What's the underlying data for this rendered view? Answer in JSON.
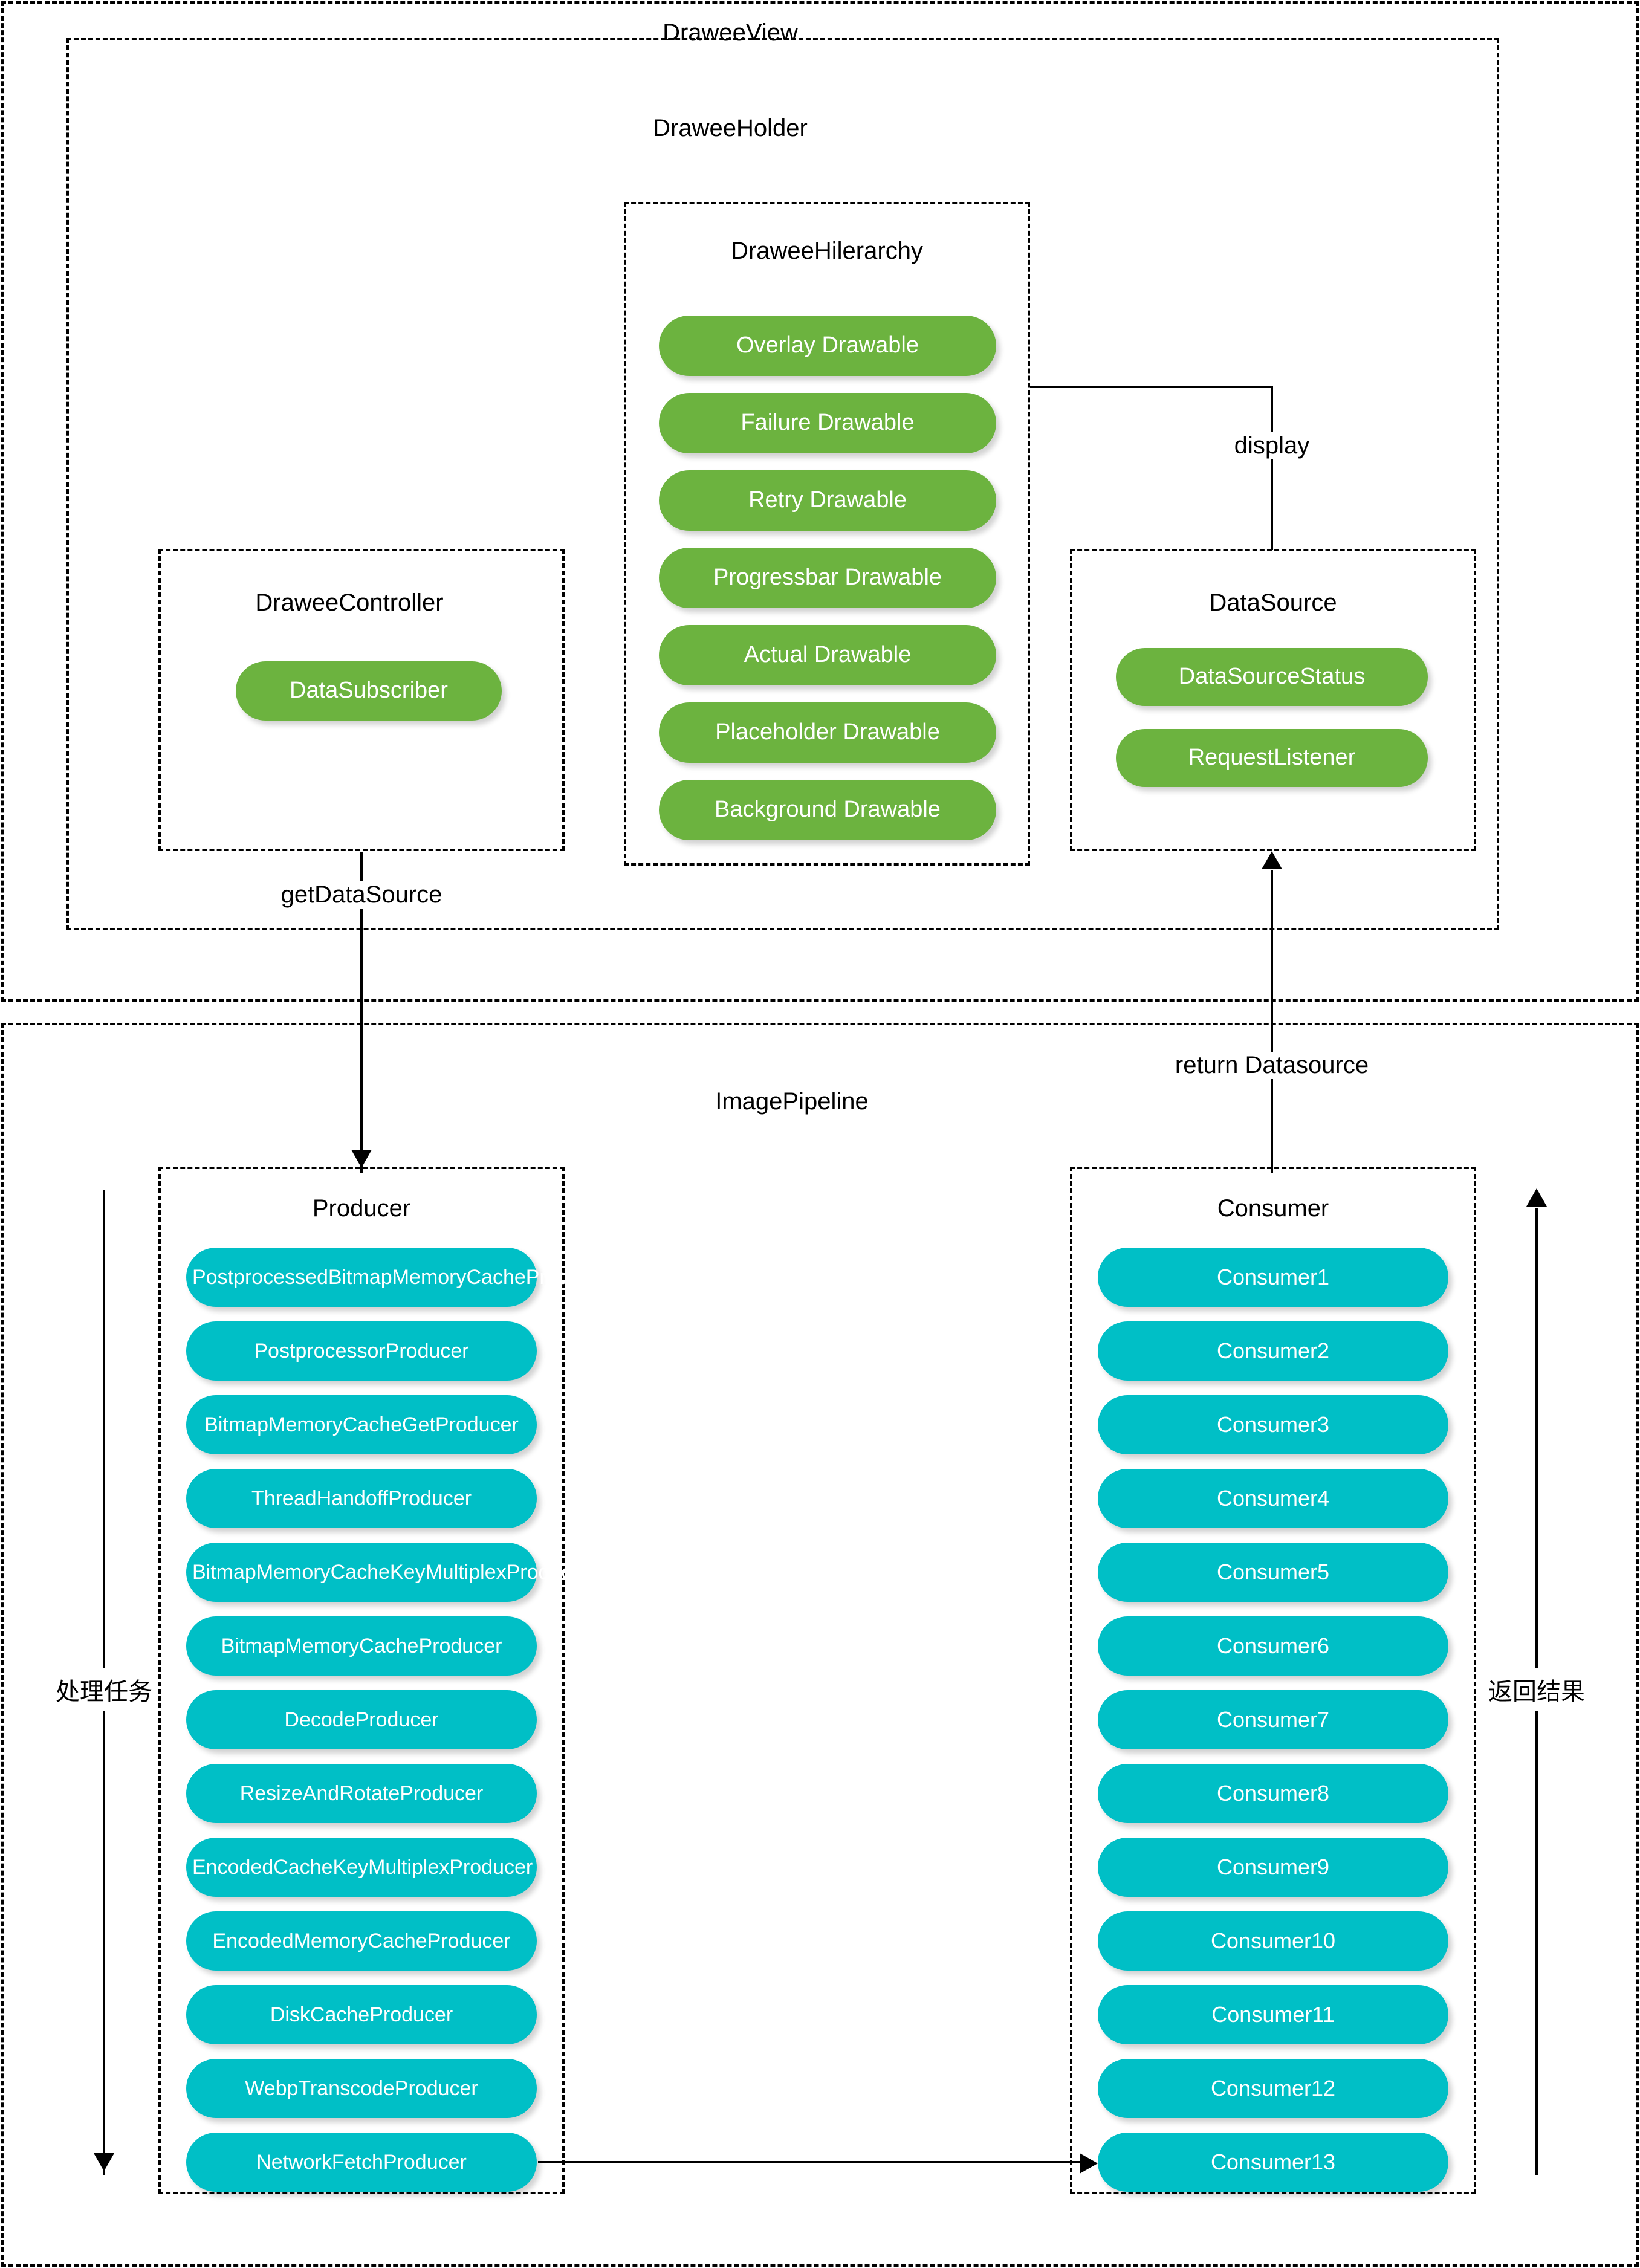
{
  "diagram": {
    "outer": {
      "drawee_view": {
        "title": "DraweeView"
      },
      "image_pipeline": {
        "title": "ImagePipeline"
      }
    },
    "drawee_holder": {
      "title": "DraweeHolder"
    },
    "drawee_hierarchy": {
      "title": "DraweeHilerarchy",
      "items": [
        "Overlay Drawable",
        "Failure Drawable",
        "Retry Drawable",
        "Progressbar Drawable",
        "Actual Drawable",
        "Placeholder Drawable",
        "Background Drawable"
      ]
    },
    "drawee_controller": {
      "title": "DraweeController",
      "items": [
        "DataSubscriber"
      ]
    },
    "data_source": {
      "title": "DataSource",
      "items": [
        "DataSourceStatus",
        "RequestListener"
      ]
    },
    "producer": {
      "title": "Producer",
      "items": [
        "PostprocessedBitmapMemoryCacheProducer",
        "PostprocessorProducer",
        "BitmapMemoryCacheGetProducer",
        "ThreadHandoffProducer",
        "BitmapMemoryCacheKeyMultiplexProducer",
        "BitmapMemoryCacheProducer",
        "DecodeProducer",
        "ResizeAndRotateProducer",
        "EncodedCacheKeyMultiplexProducer",
        "EncodedMemoryCacheProducer",
        "DiskCacheProducer",
        "WebpTranscodeProducer",
        "NetworkFetchProducer"
      ]
    },
    "consumer": {
      "title": "Consumer",
      "items": [
        "Consumer1",
        "Consumer2",
        "Consumer3",
        "Consumer4",
        "Consumer5",
        "Consumer6",
        "Consumer7",
        "Consumer8",
        "Consumer9",
        "Consumer10",
        "Consumer11",
        "Consumer12",
        "Consumer13"
      ]
    },
    "edges": {
      "display": "display",
      "get_data_source": "getDataSource",
      "return_datasource": "return Datasource",
      "process_task": "处理任务",
      "return_result": "返回结果"
    },
    "colors": {
      "green": "#6cb33f",
      "teal": "#00bfc6",
      "line": "#000000",
      "background": "#ffffff"
    }
  }
}
